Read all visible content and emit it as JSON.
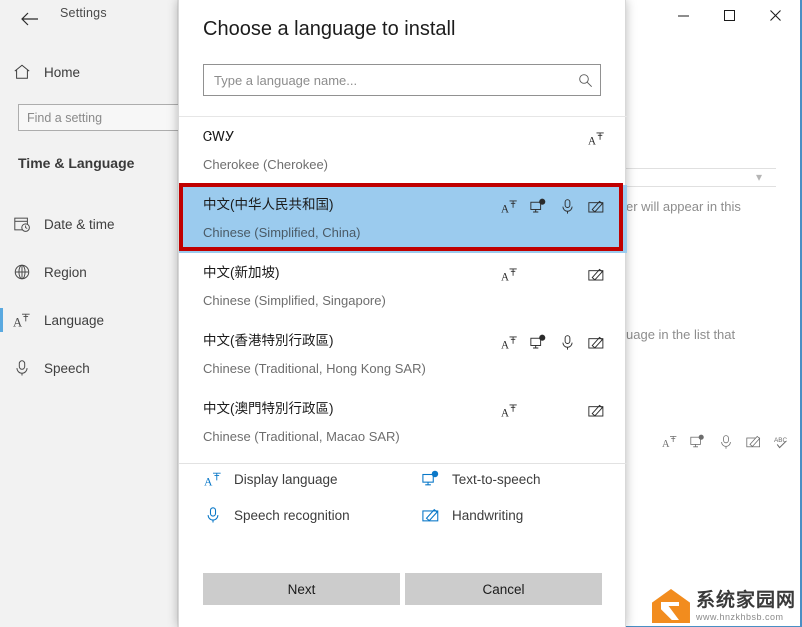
{
  "window": {
    "title": "Settings",
    "back_icon": "back-arrow-icon",
    "controls": {
      "minimize": "—",
      "maximize": "☐",
      "close": "✕"
    }
  },
  "sidebar": {
    "home": {
      "label": "Home",
      "icon": "home-icon"
    },
    "search": {
      "placeholder": "Find a setting",
      "value": ""
    },
    "section_title": "Time & Language",
    "items": [
      {
        "label": "Date & time",
        "icon": "calendar-clock-icon",
        "selected": false
      },
      {
        "label": "Region",
        "icon": "globe-icon",
        "selected": false
      },
      {
        "label": "Language",
        "icon": "display-language-icon",
        "selected": true
      },
      {
        "label": "Speech",
        "icon": "microphone-icon",
        "selected": false
      }
    ]
  },
  "background": {
    "text_fragment_1": "er will appear in this",
    "text_fragment_2": "uage in the list that",
    "icons": [
      "display-language-icon",
      "text-to-speech-icon",
      "microphone-icon",
      "handwriting-icon",
      "spell-check-icon"
    ]
  },
  "dialog": {
    "title": "Choose a language to install",
    "search": {
      "placeholder": "Type a language name...",
      "value": "",
      "icon": "search-icon"
    },
    "languages": [
      {
        "native": "ᏣᎳᎩ",
        "english": "Cherokee (Cherokee)",
        "selected": false,
        "features": [
          "display-language"
        ]
      },
      {
        "native": "中文(中华人民共和国)",
        "english": "Chinese (Simplified, China)",
        "selected": true,
        "features": [
          "display-language",
          "text-to-speech",
          "speech-recognition",
          "handwriting"
        ]
      },
      {
        "native": "中文(新加坡)",
        "english": "Chinese (Simplified, Singapore)",
        "selected": false,
        "features": [
          "display-language",
          "handwriting"
        ]
      },
      {
        "native": "中文(香港特別行政區)",
        "english": "Chinese (Traditional, Hong Kong SAR)",
        "selected": false,
        "features": [
          "display-language",
          "text-to-speech",
          "speech-recognition",
          "handwriting"
        ]
      },
      {
        "native": "中文(澳門特別行政區)",
        "english": "Chinese (Traditional, Macao SAR)",
        "selected": false,
        "features": [
          "display-language",
          "handwriting"
        ]
      }
    ],
    "legend": [
      {
        "label": "Display language",
        "icon": "display-language-icon"
      },
      {
        "label": "Text-to-speech",
        "icon": "text-to-speech-icon"
      },
      {
        "label": "Speech recognition",
        "icon": "microphone-icon"
      },
      {
        "label": "Handwriting",
        "icon": "handwriting-icon"
      }
    ],
    "buttons": {
      "next": "Next",
      "cancel": "Cancel"
    }
  },
  "annotation": {
    "highlight_color": "#c00000",
    "selection_color": "#9bcbee"
  },
  "watermark": {
    "name": "系统家园网",
    "url": "www.hnzkhbsb.com"
  }
}
